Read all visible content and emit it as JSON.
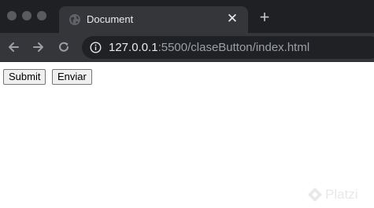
{
  "browser": {
    "tab": {
      "title": "Document",
      "favicon": "globe-icon",
      "close_icon": "close-icon"
    },
    "new_tab_icon": "plus-icon",
    "nav": {
      "back_icon": "arrow-left-icon",
      "forward_icon": "arrow-right-icon",
      "reload_icon": "reload-icon"
    },
    "address_bar": {
      "security_icon": "info-icon",
      "url_host": "127.0.0.1",
      "url_rest": ":5500/claseButton/index.html"
    }
  },
  "page": {
    "buttons": [
      {
        "label": "Submit"
      },
      {
        "label": "Enviar"
      }
    ]
  },
  "watermark": {
    "text": "Platzi"
  },
  "colors": {
    "tab_strip": "#1f2023",
    "toolbar": "#35363a",
    "omnibox": "#202124",
    "text_primary": "#e8eaed",
    "text_muted": "#9aa0a6"
  }
}
